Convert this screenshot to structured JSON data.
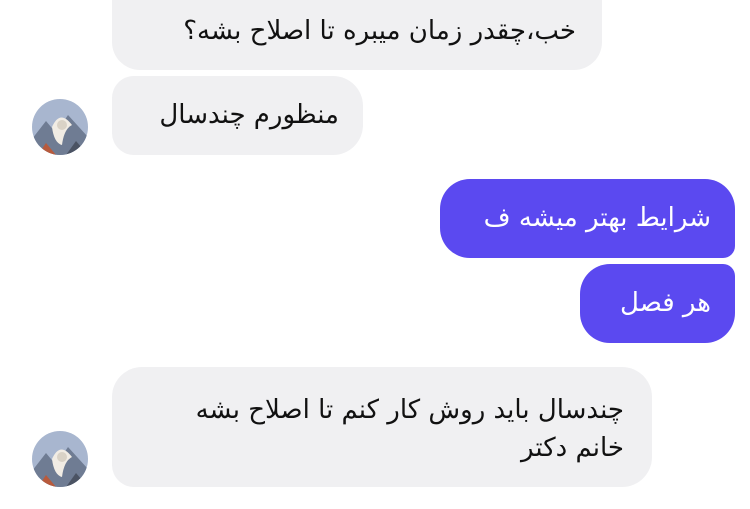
{
  "messages": [
    {
      "sender": "them",
      "text": "خب،چقدر زمان میبره تا اصلاح بشه؟"
    },
    {
      "sender": "them",
      "text": "منظورم چندسال"
    },
    {
      "sender": "me",
      "text": "شرایط بهتر میشه ف"
    },
    {
      "sender": "me",
      "text": "هر فصل"
    },
    {
      "sender": "them",
      "text_line1": "چندسال باید روش کار کنم تا اصلاح بشه",
      "text_line2": "خانم دکتر"
    }
  ],
  "colors": {
    "incoming_bubble": "#f0f0f2",
    "outgoing_bubble": "#5b49f0",
    "outgoing_text": "#ffffff"
  },
  "icons": {
    "avatar": "contact-avatar-photo"
  }
}
